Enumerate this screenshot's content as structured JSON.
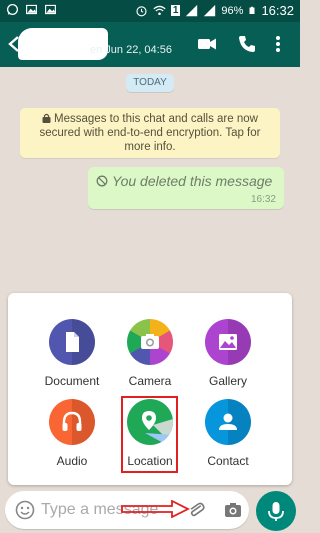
{
  "statusbar": {
    "battery": "96%",
    "sim": "1",
    "time": "16:32"
  },
  "appbar": {
    "subtitle_fragment": "en Jun 22, 04:56",
    "icons": [
      "back-arrow-icon",
      "video-call-icon",
      "phone-call-icon",
      "more-vert-icon"
    ]
  },
  "chat": {
    "date_chip": "TODAY",
    "encryption_notice": "Messages to this chat and calls are now secured with end-to-end encryption. Tap for more info.",
    "deleted_message": "You deleted this message",
    "deleted_time": "16:32"
  },
  "attach": {
    "items": [
      {
        "label": "Document",
        "color": "#5157ae",
        "icon": "document-icon"
      },
      {
        "label": "Camera",
        "color": "#e6567a",
        "icon": "camera-icon"
      },
      {
        "label": "Gallery",
        "color": "#ac44cf",
        "icon": "gallery-icon"
      },
      {
        "label": "Audio",
        "color": "#f96533",
        "icon": "headphones-icon"
      },
      {
        "label": "Location",
        "color": "#1fa855",
        "icon": "location-pin-icon"
      },
      {
        "label": "Contact",
        "color": "#0795dc",
        "icon": "contact-person-icon"
      }
    ]
  },
  "input": {
    "placeholder": "Type a message"
  },
  "colors": {
    "header": "#075e54",
    "statusbar": "#054d44",
    "bubble": "#dcf8c6",
    "fab": "#00897b",
    "highlight": "#e0211f"
  }
}
